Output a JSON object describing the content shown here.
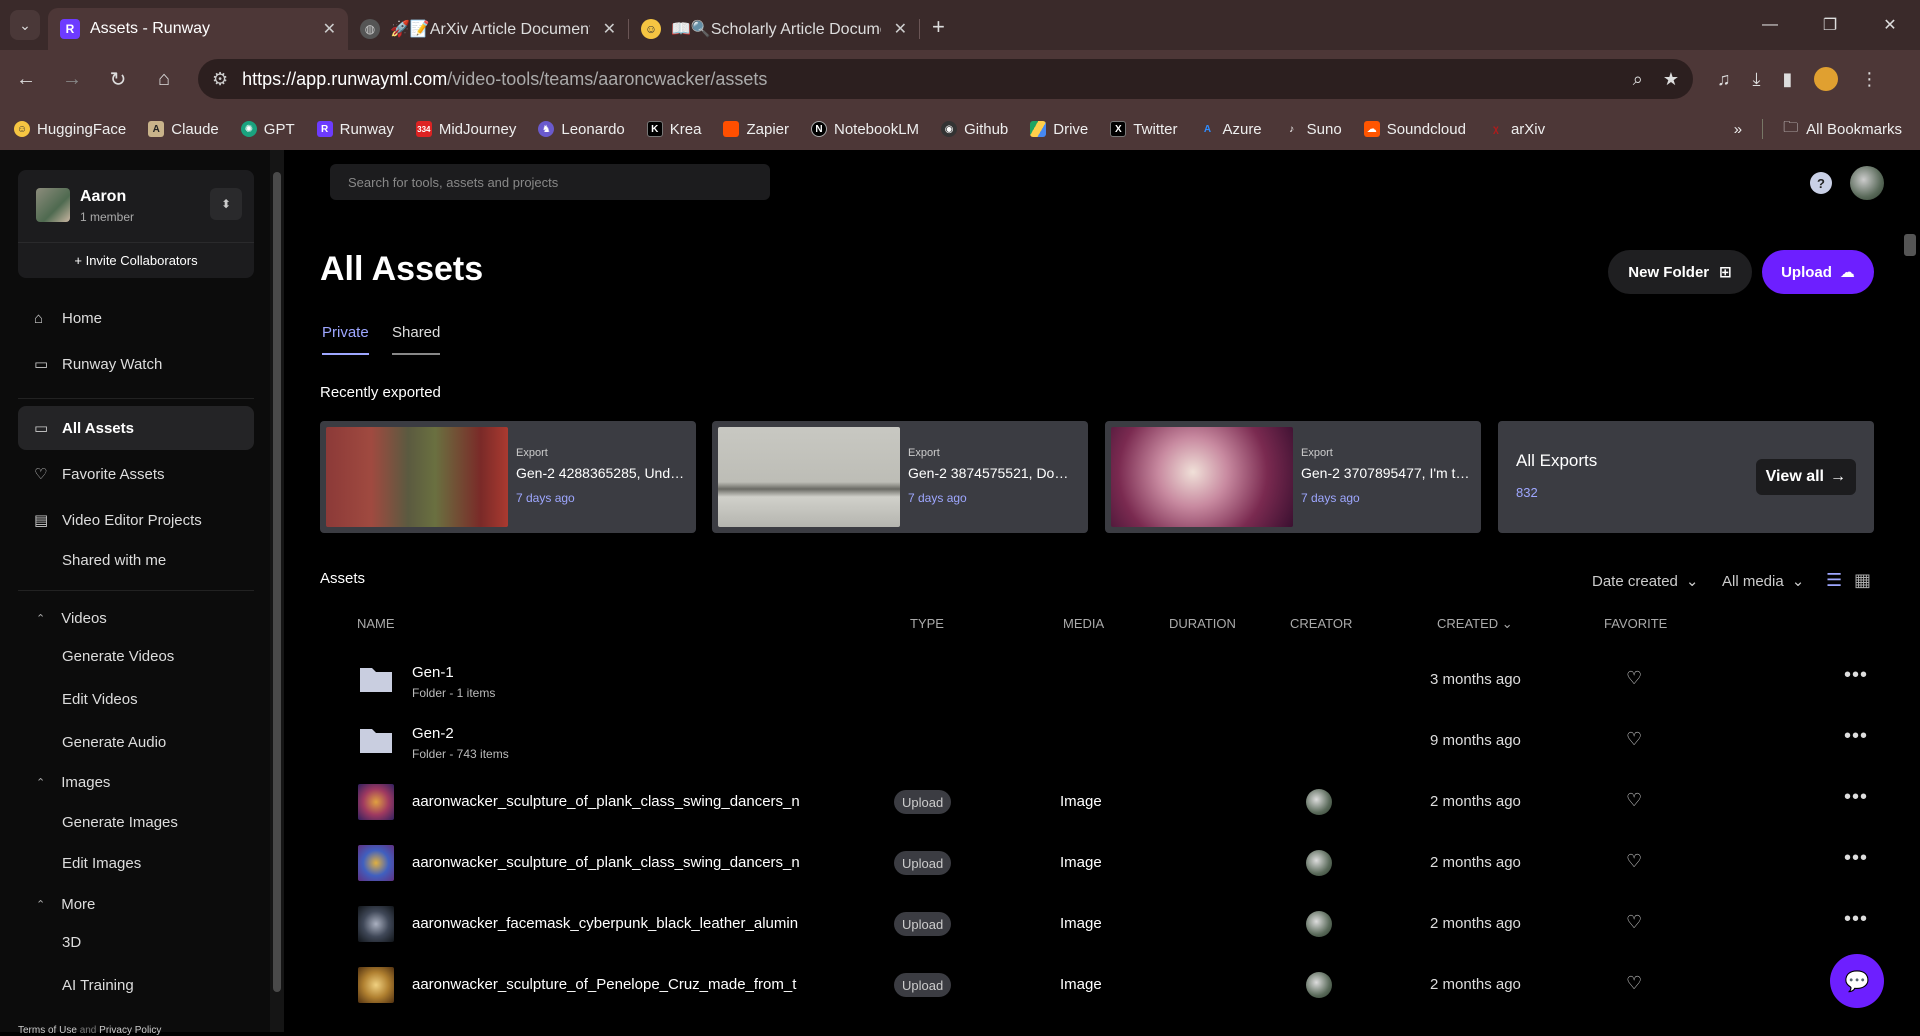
{
  "browser": {
    "tabs": [
      {
        "title": "Assets - Runway",
        "active": true
      },
      {
        "title": "🚀📝ArXiv Article Document S",
        "active": false
      },
      {
        "title": "📖🔍Scholarly Article Docume",
        "active": false
      }
    ],
    "url_host": "https://app.runwayml.com",
    "url_path": "/video-tools/teams/aaroncwacker/assets",
    "bookmarks": [
      "HuggingFace",
      "Claude",
      "GPT",
      "Runway",
      "MidJourney",
      "Leonardo",
      "Krea",
      "Zapier",
      "NotebookLM",
      "Github",
      "Drive",
      "Twitter",
      "Azure",
      "Suno",
      "Soundcloud",
      "arXiv"
    ],
    "all_bookmarks": "All Bookmarks",
    "midjourney_badge": "334"
  },
  "sidebar": {
    "team_name": "Aaron",
    "team_members": "1 member",
    "invite": "+ Invite Collaborators",
    "home": "Home",
    "watch": "Runway Watch",
    "all_assets": "All Assets",
    "favorites": "Favorite Assets",
    "video_projects": "Video Editor Projects",
    "shared_with_me": "Shared with me",
    "videos": "Videos",
    "generate_videos": "Generate Videos",
    "edit_videos": "Edit Videos",
    "generate_audio": "Generate Audio",
    "images": "Images",
    "generate_images": "Generate Images",
    "edit_images": "Edit Images",
    "more": "More",
    "three_d": "3D",
    "ai_training": "AI Training",
    "terms": "Terms of Use",
    "and": "and",
    "privacy": "Privacy Policy"
  },
  "main": {
    "search_placeholder": "Search for tools, assets and projects",
    "title": "All Assets",
    "new_folder": "New Folder",
    "upload": "Upload",
    "tab_private": "Private",
    "tab_shared": "Shared",
    "recently_exported": "Recently exported",
    "exports": [
      {
        "tag": "Export",
        "name": "Gen-2 4288365285, Unde...",
        "date": "7 days ago"
      },
      {
        "tag": "Export",
        "name": "Gen-2 3874575521, Down i...",
        "date": "7 days ago"
      },
      {
        "tag": "Export",
        "name": "Gen-2 3707895477, I'm th...",
        "date": "7 days ago"
      }
    ],
    "all_exports_title": "All Exports",
    "all_exports_count": "832",
    "view_all": "View all",
    "assets_title": "Assets",
    "sort_label": "Date created",
    "media_filter": "All media",
    "columns": {
      "name": "NAME",
      "type": "TYPE",
      "media": "MEDIA",
      "duration": "DURATION",
      "creator": "CREATOR",
      "created": "CREATED",
      "favorite": "FAVORITE"
    },
    "rows": [
      {
        "name": "Gen-1",
        "sub": "Folder - 1 items",
        "type": "",
        "media": "",
        "created": "3 months ago"
      },
      {
        "name": "Gen-2",
        "sub": "Folder - 743 items",
        "type": "",
        "media": "",
        "created": "9 months ago"
      },
      {
        "name": "aaronwacker_sculpture_of_plank_class_swing_dancers_n",
        "sub": "",
        "type": "Upload",
        "media": "Image",
        "created": "2 months ago"
      },
      {
        "name": "aaronwacker_sculpture_of_plank_class_swing_dancers_n",
        "sub": "",
        "type": "Upload",
        "media": "Image",
        "created": "2 months ago"
      },
      {
        "name": "aaronwacker_facemask_cyberpunk_black_leather_alumin",
        "sub": "",
        "type": "Upload",
        "media": "Image",
        "created": "2 months ago"
      },
      {
        "name": "aaronwacker_sculpture_of_Penelope_Cruz_made_from_t",
        "sub": "",
        "type": "Upload",
        "media": "Image",
        "created": "2 months ago"
      }
    ]
  },
  "colors": {
    "accent": "#6d1fff",
    "link": "#9ea7ff",
    "chrome": "#4d3737"
  }
}
